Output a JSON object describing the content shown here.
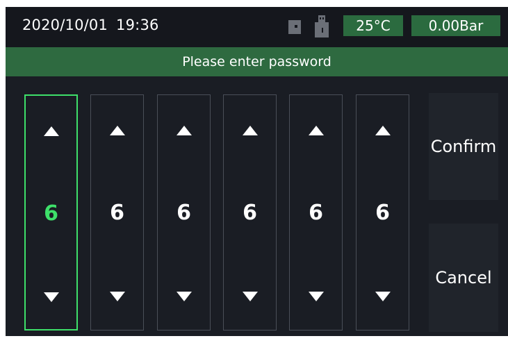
{
  "status_bar": {
    "date": "2020/10/01",
    "time": "19:36",
    "temperature": "25°C",
    "pressure": "0.00Bar",
    "icons": [
      "sd-card-icon",
      "usb-icon"
    ]
  },
  "banner": {
    "text": "Please enter password"
  },
  "password": {
    "digits": [
      "6",
      "6",
      "6",
      "6",
      "6",
      "6"
    ],
    "active_index": 0
  },
  "actions": {
    "confirm_label": "Confirm",
    "cancel_label": "Cancel"
  },
  "colors": {
    "accent": "#3ee06a",
    "banner": "#2e6a40",
    "background": "#1a1d24"
  }
}
